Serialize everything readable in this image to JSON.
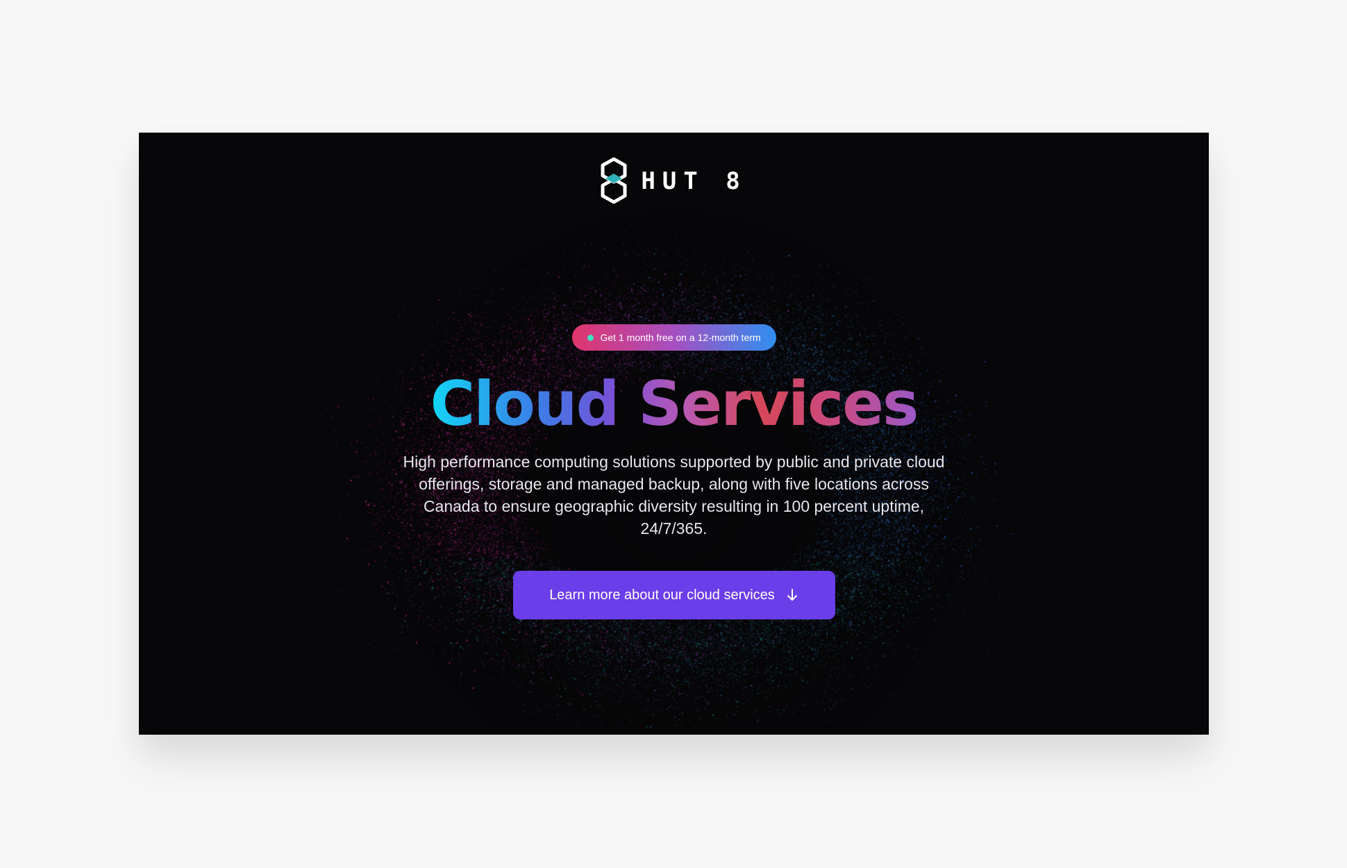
{
  "brand": {
    "name": "HUT 8",
    "icon": "hut8-hexagon-logo-icon"
  },
  "promo": {
    "text": "Get 1 month free on a 12-month term",
    "dot_color": "#3de3c2",
    "gradient": [
      "#e0356d",
      "#a64fc1",
      "#2f8ff0"
    ]
  },
  "hero": {
    "title": "Cloud Services",
    "description": "High performance computing solutions supported by public and private cloud offerings, storage and managed backup, along with five locations across Canada to ensure geographic diversity resulting in 100 percent uptime, 24/7/365.",
    "background_color": "#070608"
  },
  "cta": {
    "label": "Learn more about our cloud services",
    "icon": "arrow-down-icon",
    "color": "#6a3ee8"
  }
}
